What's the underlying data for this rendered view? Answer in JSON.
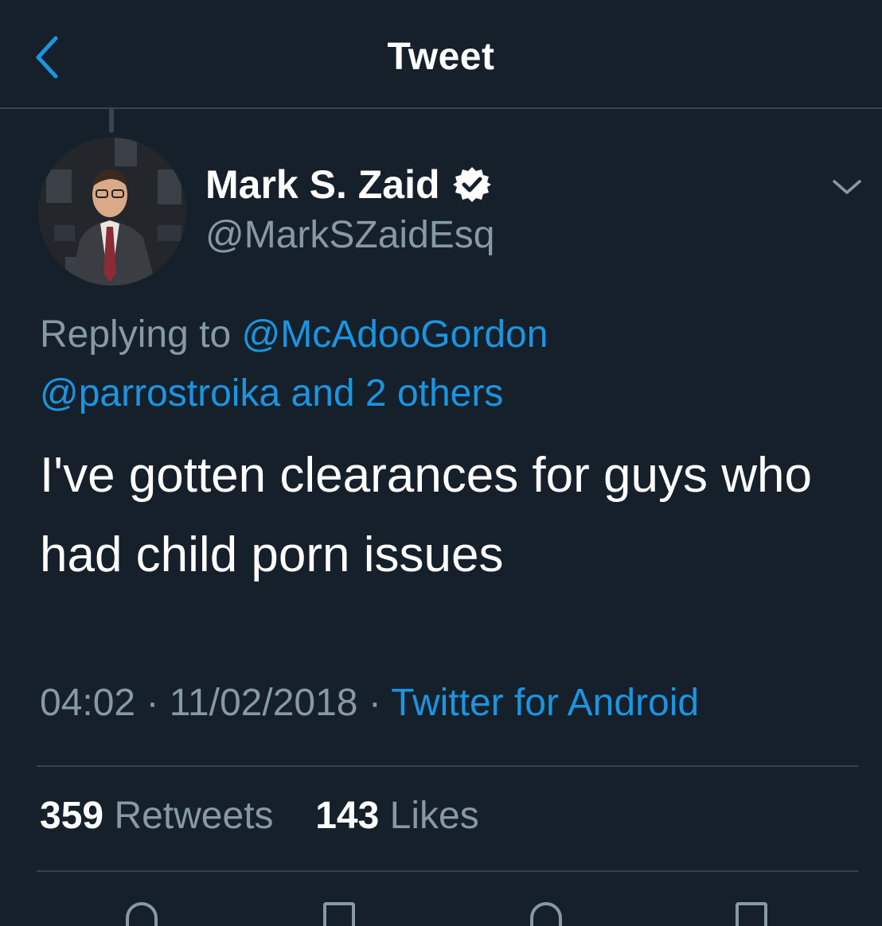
{
  "header": {
    "title": "Tweet",
    "back_icon": "chevron-left-icon"
  },
  "colors": {
    "background": "#15202b",
    "divider": "#38444d",
    "link": "#1b95e0",
    "secondary_text": "#8899a6",
    "primary_text": "#ffffff"
  },
  "tweet": {
    "author": {
      "display_name": "Mark S. Zaid",
      "handle": "@MarkSZaidEsq",
      "verified": true
    },
    "replying_to": {
      "prefix": "Replying to",
      "mention_1": "@McAdooGordon",
      "mention_2": "@parrostroika",
      "others": "and 2 others"
    },
    "text": "I've gotten clearances for guys who had child porn issues",
    "time": "04:02",
    "separator": "·",
    "date": "11/02/2018",
    "source": "Twitter for Android"
  },
  "stats": {
    "retweets_count": "359",
    "retweets_label": "Retweets",
    "likes_count": "143",
    "likes_label": "Likes"
  }
}
